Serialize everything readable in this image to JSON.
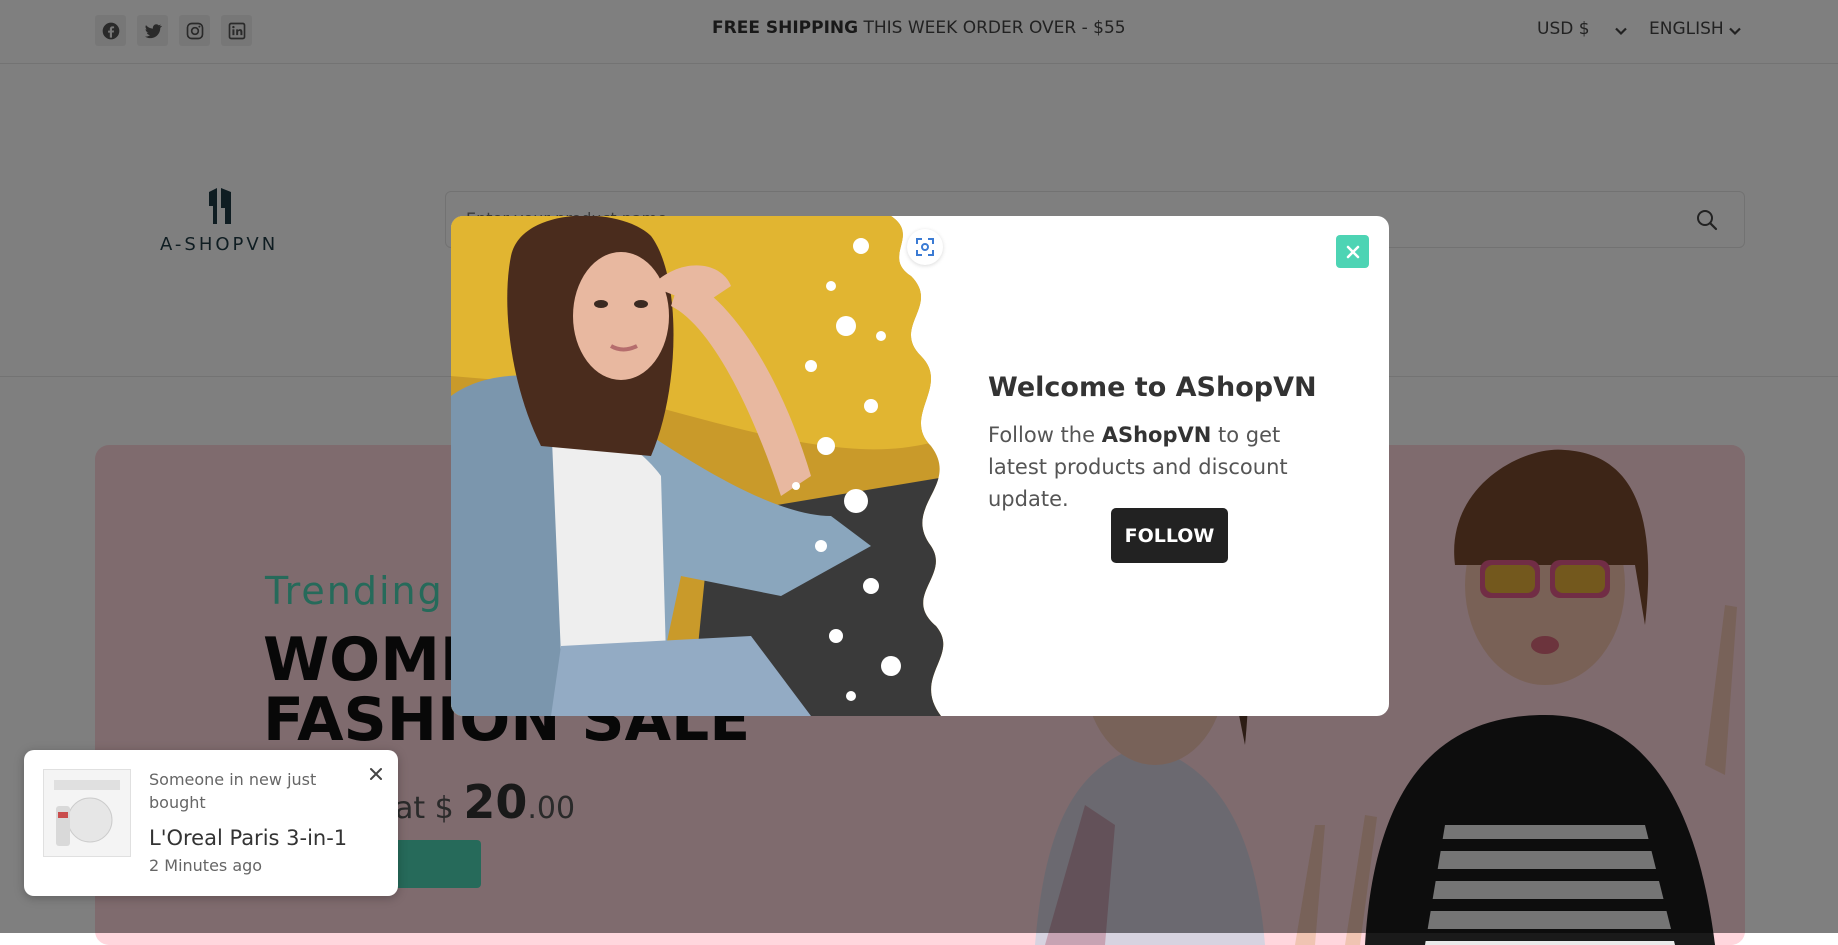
{
  "topbar": {
    "shipping_bold": "FREE SHIPPING",
    "shipping_rest": " THIS WEEK ORDER OVER - $55",
    "currency": "USD $",
    "language": "ENGLISH",
    "social_icons": [
      "facebook-icon",
      "twitter-icon",
      "instagram-icon",
      "linkedin-icon"
    ]
  },
  "header": {
    "logo_text": "A-SHOPVN",
    "search_placeholder": "Enter your product name..."
  },
  "hero": {
    "subtitle": "Trending",
    "title_line1": "WOMEN",
    "title_line2": "FASHION SALE",
    "price_prefix": "at $ ",
    "price_whole": "20",
    "price_cents": ".00"
  },
  "modal": {
    "title": "Welcome to AShopVN",
    "text_before": "Follow the ",
    "text_brand": "AShopVN",
    "text_after": " to get latest products and discount update.",
    "follow_label": "FOLLOW"
  },
  "toast": {
    "line1": "Someone in new just bought",
    "product": "L'Oreal Paris 3-in-1",
    "time": "2 Minutes ago"
  },
  "colors": {
    "accent": "#4dd4b4",
    "dark_button": "#222222",
    "hero_bg": "#ffd6dd"
  }
}
